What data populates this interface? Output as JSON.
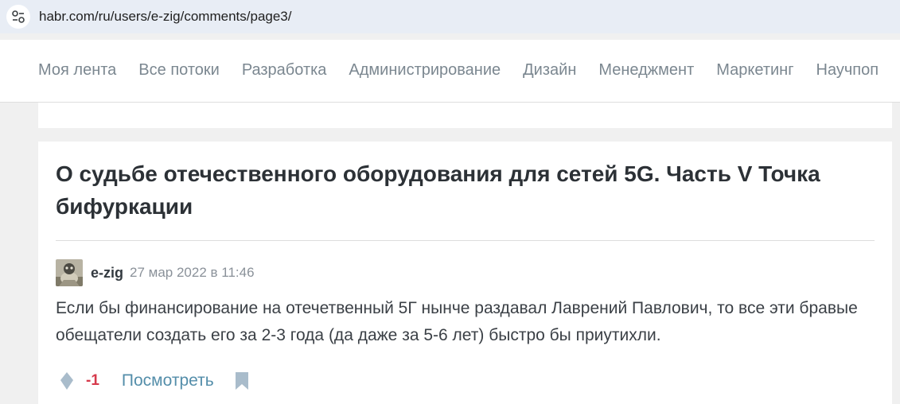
{
  "browser": {
    "url": "habr.com/ru/users/e-zig/comments/page3/",
    "site_info_icon": "tune-icon"
  },
  "nav": {
    "items": [
      "Моя лента",
      "Все потоки",
      "Разработка",
      "Администрирование",
      "Дизайн",
      "Менеджмент",
      "Маркетинг",
      "Научпоп"
    ]
  },
  "comment_card": {
    "article_title": "О судьбе отечественного оборудования для сетей 5G. Часть V Точка бифуркации",
    "author": "e-zig",
    "date": "27 мар 2022 в 11:46",
    "text": "Если бы финансирование на отечетвенный 5Г нынче раздавал Лаврений Павлович, то все эти бравые обещатели создать его за 2-3 года (да даже за 5-6 лет) быстро бы приутихли.",
    "score": "-1",
    "view_label": "Посмотреть"
  },
  "colors": {
    "score_negative": "#d6394b",
    "link": "#548eaa",
    "nav_text": "#7b8790",
    "page_bg": "#f0f0f0"
  }
}
